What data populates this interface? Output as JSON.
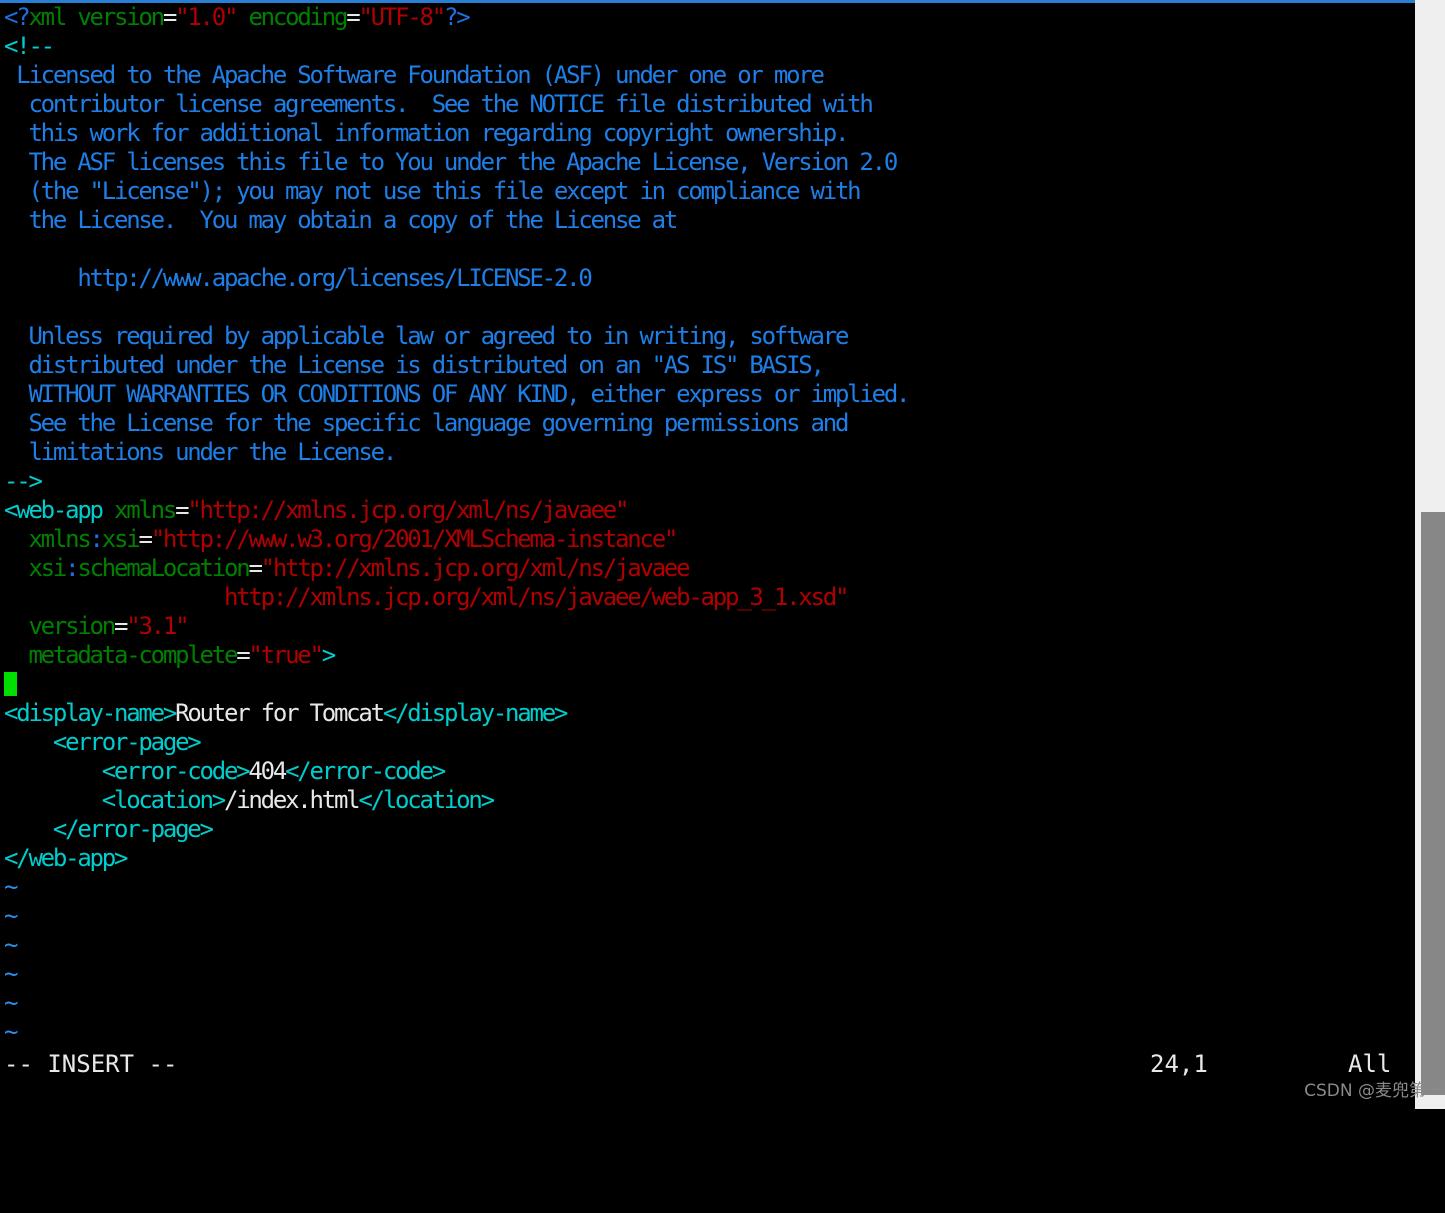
{
  "app": {
    "name": "vim",
    "theme": "dark-terminal",
    "background_color": "#000000",
    "top_border_color": "#2a7fd4"
  },
  "editor": {
    "filetype": "xml",
    "lines": [
      {
        "n": 1,
        "segments": [
          {
            "cls": "t-delim",
            "text": "<?"
          },
          {
            "cls": "t-name",
            "text": "xml version"
          },
          {
            "cls": "t-eq",
            "text": "="
          },
          {
            "cls": "t-val",
            "text": "\"1.0\""
          },
          {
            "cls": "t-name",
            "text": " encoding"
          },
          {
            "cls": "t-eq",
            "text": "="
          },
          {
            "cls": "t-val",
            "text": "\"UTF-8\""
          },
          {
            "cls": "t-delim",
            "text": "?>"
          }
        ]
      },
      {
        "n": 2,
        "segments": [
          {
            "cls": "t-tag",
            "text": "<!--"
          }
        ]
      },
      {
        "n": 3,
        "segments": [
          {
            "cls": "t-comment",
            "text": " Licensed to the Apache Software Foundation (ASF) under one or more"
          }
        ]
      },
      {
        "n": 4,
        "segments": [
          {
            "cls": "t-comment",
            "text": "  contributor license agreements.  See the NOTICE file distributed with"
          }
        ]
      },
      {
        "n": 5,
        "segments": [
          {
            "cls": "t-comment",
            "text": "  this work for additional information regarding copyright ownership."
          }
        ]
      },
      {
        "n": 6,
        "segments": [
          {
            "cls": "t-comment",
            "text": "  The ASF licenses this file to You under the Apache License, Version 2.0"
          }
        ]
      },
      {
        "n": 7,
        "segments": [
          {
            "cls": "t-comment",
            "text": "  (the \"License\"); you may not use this file except in compliance with"
          }
        ]
      },
      {
        "n": 8,
        "segments": [
          {
            "cls": "t-comment",
            "text": "  the License.  You may obtain a copy of the License at"
          }
        ]
      },
      {
        "n": 9,
        "segments": [
          {
            "cls": "t-comment",
            "text": ""
          }
        ]
      },
      {
        "n": 10,
        "segments": [
          {
            "cls": "t-comment",
            "text": "      http://www.apache.org/licenses/LICENSE-2.0"
          }
        ]
      },
      {
        "n": 11,
        "segments": [
          {
            "cls": "t-comment",
            "text": ""
          }
        ]
      },
      {
        "n": 12,
        "segments": [
          {
            "cls": "t-comment",
            "text": "  Unless required by applicable law or agreed to in writing, software"
          }
        ]
      },
      {
        "n": 13,
        "segments": [
          {
            "cls": "t-comment",
            "text": "  distributed under the License is distributed on an \"AS IS\" BASIS,"
          }
        ]
      },
      {
        "n": 14,
        "segments": [
          {
            "cls": "t-comment",
            "text": "  WITHOUT WARRANTIES OR CONDITIONS OF ANY KIND, either express or implied."
          }
        ]
      },
      {
        "n": 15,
        "segments": [
          {
            "cls": "t-comment",
            "text": "  See the License for the specific language governing permissions and"
          }
        ]
      },
      {
        "n": 16,
        "segments": [
          {
            "cls": "t-comment",
            "text": "  limitations under the License."
          }
        ]
      },
      {
        "n": 17,
        "segments": [
          {
            "cls": "t-tag",
            "text": "-->"
          }
        ]
      },
      {
        "n": 18,
        "segments": [
          {
            "cls": "t-tag",
            "text": "<web-app"
          },
          {
            "cls": "t-name",
            "text": " xmlns"
          },
          {
            "cls": "t-eq",
            "text": "="
          },
          {
            "cls": "t-val",
            "text": "\"http://xmlns.jcp.org/xml/ns/javaee\""
          }
        ]
      },
      {
        "n": 19,
        "segments": [
          {
            "cls": "t-name",
            "text": "  xmlns"
          },
          {
            "cls": "t-delim",
            "text": ":"
          },
          {
            "cls": "t-name",
            "text": "xsi"
          },
          {
            "cls": "t-eq",
            "text": "="
          },
          {
            "cls": "t-val",
            "text": "\"http://www.w3.org/2001/XMLSchema-instance\""
          }
        ]
      },
      {
        "n": 20,
        "segments": [
          {
            "cls": "t-name",
            "text": "  xsi"
          },
          {
            "cls": "t-delim",
            "text": ":"
          },
          {
            "cls": "t-name",
            "text": "schemaLocation"
          },
          {
            "cls": "t-eq",
            "text": "="
          },
          {
            "cls": "t-val",
            "text": "\"http://xmlns.jcp.org/xml/ns/javaee"
          }
        ]
      },
      {
        "n": 21,
        "segments": [
          {
            "cls": "t-val",
            "text": "                  http://xmlns.jcp.org/xml/ns/javaee/web-app_3_1.xsd\""
          }
        ]
      },
      {
        "n": 22,
        "segments": [
          {
            "cls": "t-name",
            "text": "  version"
          },
          {
            "cls": "t-eq",
            "text": "="
          },
          {
            "cls": "t-val",
            "text": "\"3.1\""
          }
        ]
      },
      {
        "n": 23,
        "segments": [
          {
            "cls": "t-name",
            "text": "  metadata-complete"
          },
          {
            "cls": "t-eq",
            "text": "="
          },
          {
            "cls": "t-val",
            "text": "\"true\""
          },
          {
            "cls": "t-tag",
            "text": ">"
          }
        ]
      },
      {
        "n": 24,
        "cursor": true,
        "segments": []
      },
      {
        "n": 25,
        "segments": [
          {
            "cls": "t-tag",
            "text": "<display-name>"
          },
          {
            "cls": "t-text",
            "text": "Router for Tomcat"
          },
          {
            "cls": "t-tag",
            "text": "</display-name>"
          }
        ]
      },
      {
        "n": 26,
        "segments": [
          {
            "cls": "t-tag",
            "text": "    <error-page>"
          }
        ]
      },
      {
        "n": 27,
        "segments": [
          {
            "cls": "t-tag",
            "text": "        <error-code>"
          },
          {
            "cls": "t-text",
            "text": "404"
          },
          {
            "cls": "t-tag",
            "text": "</error-code>"
          }
        ]
      },
      {
        "n": 28,
        "segments": [
          {
            "cls": "t-tag",
            "text": "        <location>"
          },
          {
            "cls": "t-text",
            "text": "/index.html"
          },
          {
            "cls": "t-tag",
            "text": "</location>"
          }
        ]
      },
      {
        "n": 29,
        "segments": [
          {
            "cls": "t-tag",
            "text": "    </error-page>"
          }
        ]
      },
      {
        "n": 30,
        "segments": [
          {
            "cls": "t-tag",
            "text": "</web-app>"
          }
        ]
      },
      {
        "n": 31,
        "segments": [
          {
            "cls": "t-tilde",
            "text": "~"
          }
        ]
      },
      {
        "n": 32,
        "segments": [
          {
            "cls": "t-tilde",
            "text": "~"
          }
        ]
      },
      {
        "n": 33,
        "segments": [
          {
            "cls": "t-tilde",
            "text": "~"
          }
        ]
      },
      {
        "n": 34,
        "segments": [
          {
            "cls": "t-tilde",
            "text": "~"
          }
        ]
      },
      {
        "n": 35,
        "segments": [
          {
            "cls": "t-tilde",
            "text": "~"
          }
        ]
      },
      {
        "n": 36,
        "segments": [
          {
            "cls": "t-tilde",
            "text": "~"
          }
        ]
      }
    ]
  },
  "statusline": {
    "mode": "-- INSERT --",
    "position": "24,1",
    "scroll": "All"
  },
  "scrollbar": {
    "track_color": "#efefef",
    "thumb_color": "#878787"
  },
  "watermark": {
    "text": "CSDN @麦兜第一"
  }
}
